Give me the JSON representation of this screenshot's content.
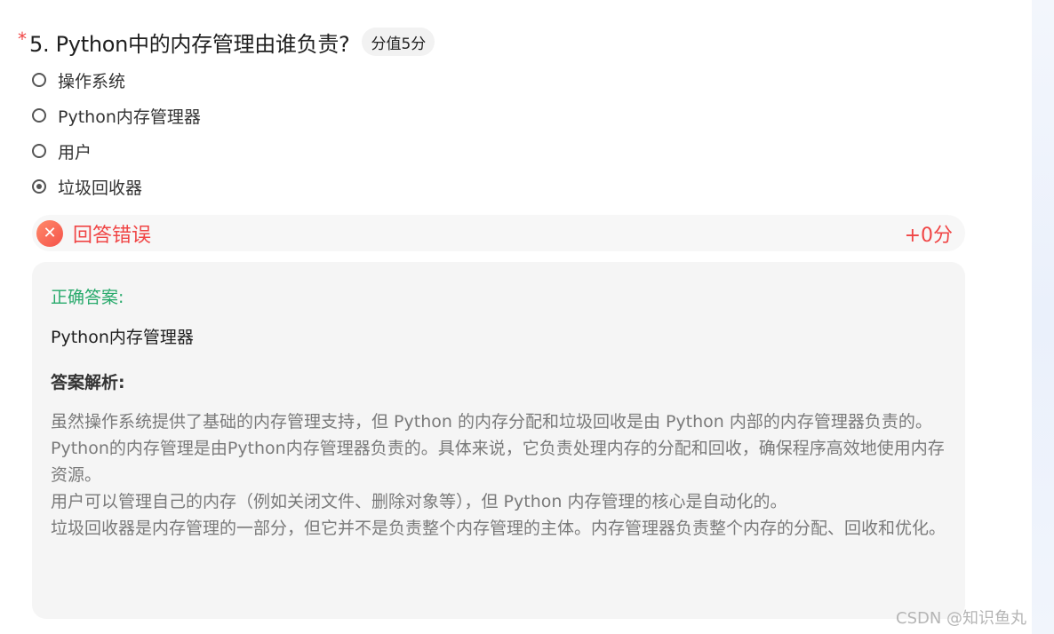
{
  "question": {
    "required_mark": "*",
    "title": "5. Python中的内存管理由谁负责?",
    "score_badge": "分值5分"
  },
  "options": [
    {
      "label": "操作系统",
      "selected": false
    },
    {
      "label": "Python内存管理器",
      "selected": false
    },
    {
      "label": "用户",
      "selected": false
    },
    {
      "label": "垃圾回收器",
      "selected": true
    }
  ],
  "result": {
    "icon": "x-icon",
    "text": "回答错误",
    "score": "+0分",
    "color": "#f04545"
  },
  "answer": {
    "correct_label": "正确答案:",
    "correct_value": "Python内存管理器",
    "analysis_title": "答案解析:",
    "analysis_lines": [
      "虽然操作系统提供了基础的内存管理支持，但 Python 的内存分配和垃圾回收是由 Python 内部的内存管理器负责的。",
      "Python的内存管理是由Python内存管理器负责的。具体来说，它负责处理内存的分配和回收，确保程序高效地使用内存资源。",
      "用户可以管理自己的内存（例如关闭文件、删除对象等），但 Python 内存管理的核心是自动化的。",
      "垃圾回收器是内存管理的一部分，但它并不是负责整个内存管理的主体。内存管理器负责整个内存的分配、回收和优化。"
    ],
    "correct_color": "#27a96b"
  },
  "watermark": "CSDN @知识鱼丸"
}
